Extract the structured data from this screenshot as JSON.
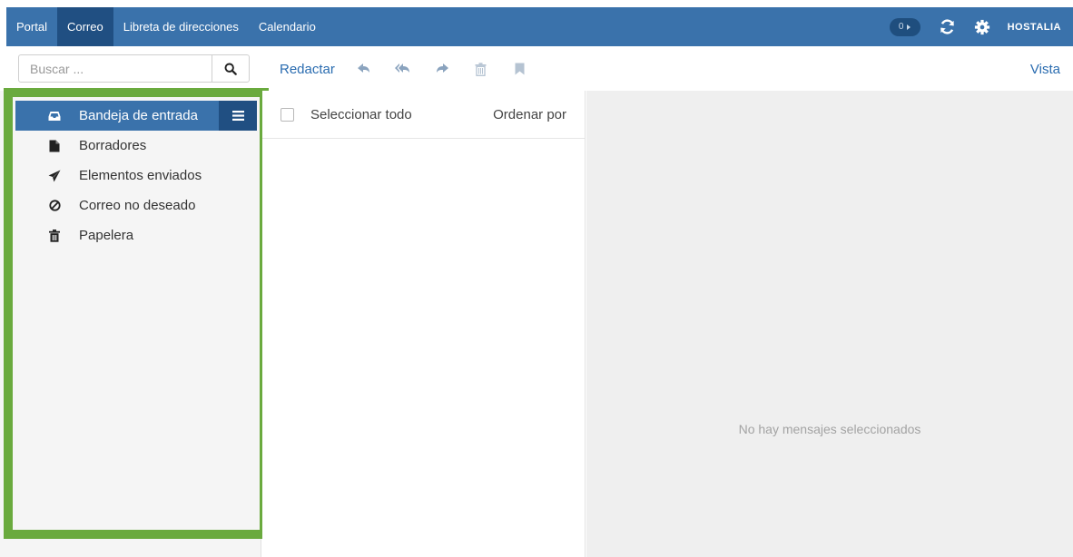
{
  "nav": {
    "items": [
      {
        "label": "Portal",
        "active": false
      },
      {
        "label": "Correo",
        "active": true
      },
      {
        "label": "Libreta de direcciones",
        "active": false
      },
      {
        "label": "Calendario",
        "active": false
      }
    ],
    "badge_count": "0",
    "brand": "HOSTALIA"
  },
  "search": {
    "placeholder": "Buscar ..."
  },
  "toolbar": {
    "compose_label": "Redactar",
    "view_label": "Vista"
  },
  "folders": [
    {
      "label": "Bandeja de entrada",
      "icon": "inbox-icon",
      "active": true
    },
    {
      "label": "Borradores",
      "icon": "file-icon",
      "active": false
    },
    {
      "label": "Elementos enviados",
      "icon": "paper-plane-icon",
      "active": false
    },
    {
      "label": "Correo no deseado",
      "icon": "ban-icon",
      "active": false
    },
    {
      "label": "Papelera",
      "icon": "trash-icon",
      "active": false
    }
  ],
  "message_list": {
    "select_all_label": "Seleccionar todo",
    "sort_label": "Ordenar por"
  },
  "preview": {
    "empty_text": "No hay mensajes seleccionados"
  },
  "colors": {
    "nav_bg": "#3a72ab",
    "nav_active": "#204f82",
    "link": "#2a6cb0",
    "highlight_frame": "#6aaa3e"
  }
}
